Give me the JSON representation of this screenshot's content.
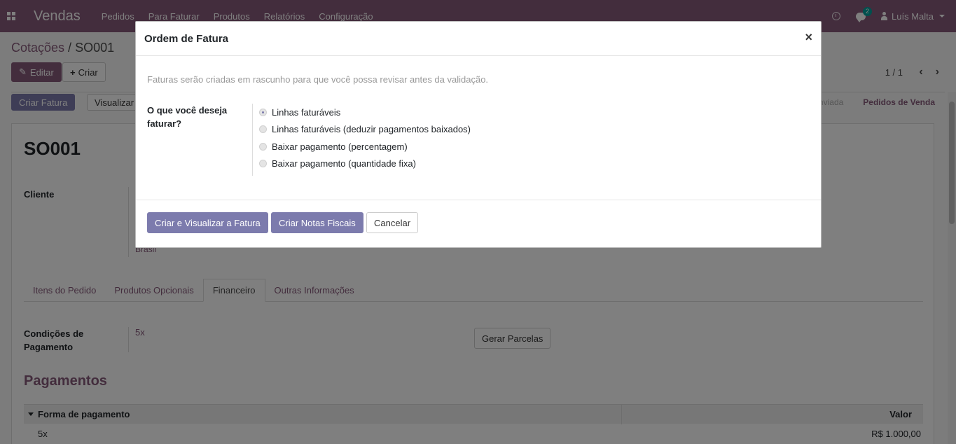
{
  "navbar": {
    "app_name": "Vendas",
    "menu": [
      "Pedidos",
      "Para Faturar",
      "Produtos",
      "Relatórios",
      "Configuração"
    ],
    "chat_badge": "2",
    "user_name": "Luís Malta"
  },
  "control": {
    "breadcrumb_parent": "Cotações",
    "breadcrumb_sep": " / ",
    "breadcrumb_current": "SO001",
    "edit_label": "Editar",
    "create_label": "Criar",
    "pager": "1 / 1"
  },
  "statusbar": {
    "invoice_label": "Criar Fatura",
    "view_label": "Visualizar",
    "steps": [
      "Enviada",
      "Pedidos de Venda"
    ]
  },
  "form": {
    "name": "SO001",
    "client_label": "Cliente",
    "client_value_partial": "Brasil",
    "tabs": [
      "Itens do Pedido",
      "Produtos Opcionais",
      "Financeiro",
      "Outras Informações"
    ],
    "payment_terms_label": "Condições de Pagamento",
    "payment_terms_value": "5x",
    "generate_button": "Gerar Parcelas",
    "payments_title": "Pagamentos",
    "payments_table": {
      "col_method": "Forma de pagamento",
      "col_value": "Valor",
      "rows": [
        {
          "method": "5x",
          "value": "R$ 1.000,00"
        }
      ]
    }
  },
  "modal": {
    "title": "Ordem de Fatura",
    "close": "×",
    "hint": "Faturas serão criadas em rascunho para que você possa revisar antes da validação.",
    "question": "O que você deseja faturar?",
    "options": [
      "Linhas faturáveis",
      "Linhas faturáveis (deduzir pagamentos baixados)",
      "Baixar pagamento (percentagem)",
      "Baixar pagamento (quantidade fixa)"
    ],
    "selected_option": "Linhas faturáveis",
    "buttons": {
      "create_view": "Criar e Visualizar a Fatura",
      "create": "Criar Notas Fiscais",
      "cancel": "Cancelar"
    }
  }
}
